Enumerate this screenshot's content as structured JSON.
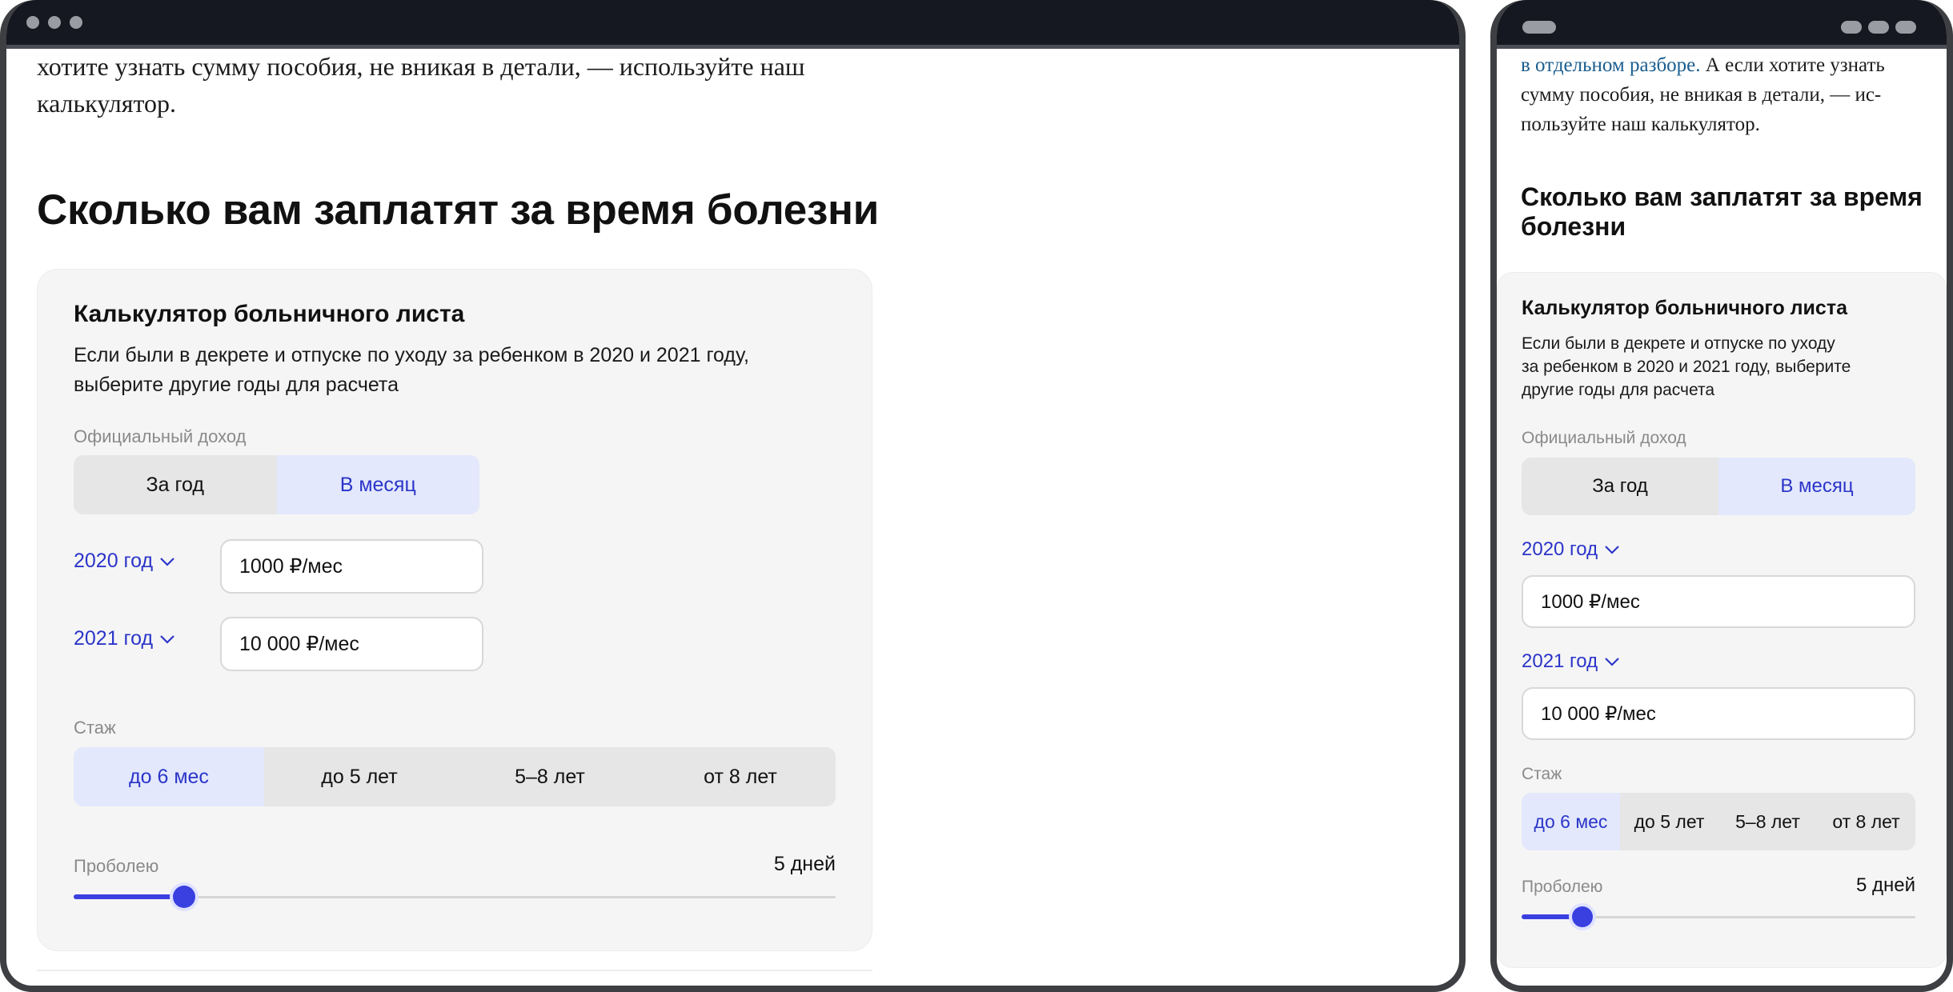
{
  "desktop": {
    "intro_line1": "хотите узнать сумму пособия, не вникая в детали, — используйте наш",
    "intro_line2": "калькулятор.",
    "heading": "Сколько вам заплатят за время болезни",
    "calc": {
      "title": "Калькулятор больничного листа",
      "desc_line1": "Если были в декрете и отпуске по уходу за ребенком в 2020 и 2021 году,",
      "desc_line2": "выберите другие годы для расчета",
      "income_label": "Официальный доход",
      "income_options": [
        "За год",
        "В месяц"
      ],
      "income_selected": "В месяц",
      "year1": "2020 год",
      "year1_value": "1000 ₽/мес",
      "year2": "2021 год",
      "year2_value": "10 000 ₽/мес",
      "exp_label": "Стаж",
      "exp_options": [
        "до 6 мес",
        "до 5 лет",
        "5–8 лет",
        "от 8 лет"
      ],
      "exp_selected": "до 6 мес",
      "sick_label": "Проболею",
      "sick_value": "5 дней",
      "sick_slider_fraction": 0.145
    }
  },
  "mobile": {
    "intro_link": "в отдельном разборе.",
    "intro_line1_rest": " А если хотите узнать",
    "intro_line2": "сумму пособия, не вникая в детали, — ис-",
    "intro_line3": "пользуйте наш калькулятор.",
    "heading_line1": "Сколько вам заплатят за время",
    "heading_line2": "болезни",
    "calc": {
      "title": "Калькулятор больничного листа",
      "desc_line1": "Если были в декрете и отпуске по уходу",
      "desc_line2": "за ребенком в 2020 и 2021 году, выберите",
      "desc_line3": "другие годы для расчета",
      "income_label": "Официальный доход",
      "income_options": [
        "За год",
        "В месяц"
      ],
      "year1": "2020 год",
      "year1_value": "1000 ₽/мес",
      "year2": "2021 год",
      "year2_value": "10 000 ₽/мес",
      "exp_label": "Стаж",
      "exp_options": [
        "до 6 мес",
        "до 5 лет",
        "5–8 лет",
        "от 8 лет"
      ],
      "sick_label": "Проболею",
      "sick_value": "5 дней",
      "sick_slider_fraction": 0.155
    }
  },
  "colors": {
    "accent": "#2b35c9",
    "slider": "#3a3fe0",
    "selected_bg": "#e3e8fc",
    "link": "#1a5d8f",
    "titlebar": "#151820"
  }
}
